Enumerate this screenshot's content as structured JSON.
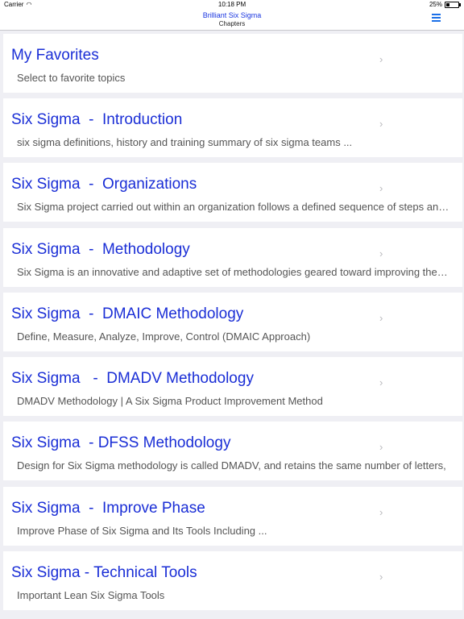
{
  "status_bar": {
    "carrier": "Carrier",
    "time": "10:18 PM",
    "battery": "25%",
    "battery_level": 0.25
  },
  "nav": {
    "title": "Brilliant Six Sigma",
    "subtitle": "Chapters",
    "menu_icon": "hamburger-menu-icon",
    "accent_color": "#1a2ed6"
  },
  "chapters": [
    {
      "title": "My Favorites",
      "description": "Select to favorite topics"
    },
    {
      "title": "Six Sigma  -  Introduction",
      "description": "six sigma definitions, history and training summary of six sigma teams ..."
    },
    {
      "title": "Six Sigma  -  Organizations",
      "description": "Six Sigma project carried out within an organization follows a defined sequence of steps and additional actions"
    },
    {
      "title": "Six Sigma  -  Methodology",
      "description": "Six Sigma is an innovative and adaptive set of methodologies geared toward improving the efficiency of processes"
    },
    {
      "title": "Six Sigma  -  DMAIC Methodology",
      "description": "Define, Measure, Analyze, Improve, Control (DMAIC Approach)"
    },
    {
      "title": "Six Sigma   -  DMADV Methodology",
      "description": "DMADV Methodology | A Six Sigma Product Improvement Method"
    },
    {
      "title": "Six Sigma  - DFSS Methodology",
      "description": "Design for Six Sigma methodology is called DMADV, and retains the same number of letters,"
    },
    {
      "title": "Six Sigma  -  Improve Phase",
      "description": "Improve Phase of Six Sigma and Its Tools Including ..."
    },
    {
      "title": "Six Sigma - Technical Tools",
      "description": "Important Lean Six Sigma Tools"
    }
  ]
}
